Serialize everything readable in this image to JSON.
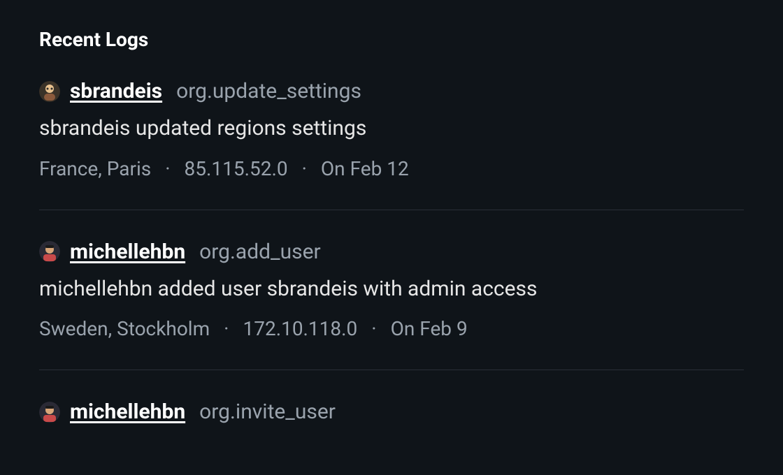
{
  "section_title": "Recent Logs",
  "logs": [
    {
      "username": "sbrandeis",
      "action": "org.update_settings",
      "message": "sbrandeis updated regions settings",
      "location": "France, Paris",
      "ip": "85.115.52.0",
      "date": "On Feb 12",
      "avatar_key": "sbrandeis"
    },
    {
      "username": "michellehbn",
      "action": "org.add_user",
      "message": "michellehbn added user sbrandeis with admin access",
      "location": "Sweden, Stockholm",
      "ip": "172.10.118.0",
      "date": "On Feb 9",
      "avatar_key": "michellehbn"
    },
    {
      "username": "michellehbn",
      "action": "org.invite_user",
      "message": "",
      "location": "",
      "ip": "",
      "date": "",
      "avatar_key": "michellehbn"
    }
  ]
}
